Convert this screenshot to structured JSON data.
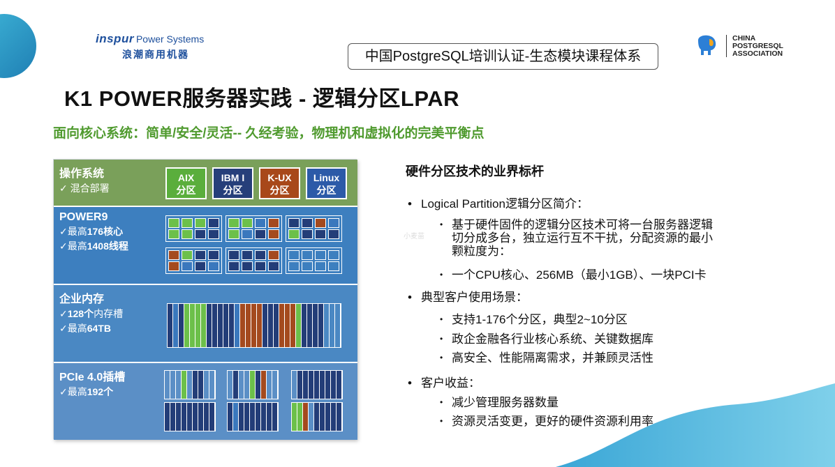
{
  "header": {
    "inspur_brand": "inspur",
    "inspur_sub": "Power Systems",
    "inspur_cn": "浪潮商用机器",
    "course": "中国PostgreSQL培训认证-生态模块课程体系",
    "cpa_line1": "CHINA",
    "cpa_line2": "POSTGRESQL",
    "cpa_line3": "ASSOCIATION"
  },
  "title": "K1 POWER服务器实践 - 逻辑分区LPAR",
  "subtitle": "面向核心系统：简单/安全/灵活-- 久经考验，物理机和虚拟化的完美平衡点",
  "diagram": {
    "os": {
      "heading": "操作系统",
      "line1": "✓   混合部署",
      "buttons": [
        {
          "top": "AIX",
          "bottom": "分区",
          "color": "#5aae3c"
        },
        {
          "top": "IBM I",
          "bottom": "分区",
          "color": "#263f7a"
        },
        {
          "top": "K-UX",
          "bottom": "分区",
          "color": "#a8481a"
        },
        {
          "top": "Linux",
          "bottom": "分区",
          "color": "#2c5aa8"
        }
      ]
    },
    "p9": {
      "heading": "POWER9",
      "line1": "✓最高",
      "line1b": "176核心",
      "line2": "✓最高",
      "line2b": "1408线程"
    },
    "mem": {
      "heading": "企业内存",
      "line1": "✓",
      "line1b": "128个",
      "line1c": "内存槽",
      "line2": "✓最高",
      "line2b": "64TB"
    },
    "pci": {
      "heading": "PCIe 4.0插槽",
      "line1": "✓最高",
      "line1b": "192个"
    },
    "colors": {
      "green": "#6cc04a",
      "navy": "#233d78",
      "rust": "#a44a1e",
      "blue": "#3a78bd"
    }
  },
  "right": {
    "title": "硬件分区技术的业界标杆",
    "b1": "Logical Partition逻辑分区简介：",
    "b1a_1": "基于硬件固件的逻辑分区技术可将一台服务器逻辑",
    "b1a_2": "切分成多台，独立运行互不干扰，分配资源的最小",
    "b1a_3": "颗粒度为：",
    "b1b": "一个CPU核心、256MB（最小1GB）、一块PCI卡",
    "b2": "典型客户使用场景：",
    "b2a": "支持1-176个分区，典型2~10分区",
    "b2b": "政企金融各行业核心系统、关键数据库",
    "b2c": "高安全、性能隔离需求，并兼顾灵活性",
    "b3": "客户收益：",
    "b3a": "减少管理服务器数量",
    "b3b": "资源灵活变更，更好的硬件资源利用率",
    "bullet": "•",
    "watermark": "小麦苗"
  }
}
